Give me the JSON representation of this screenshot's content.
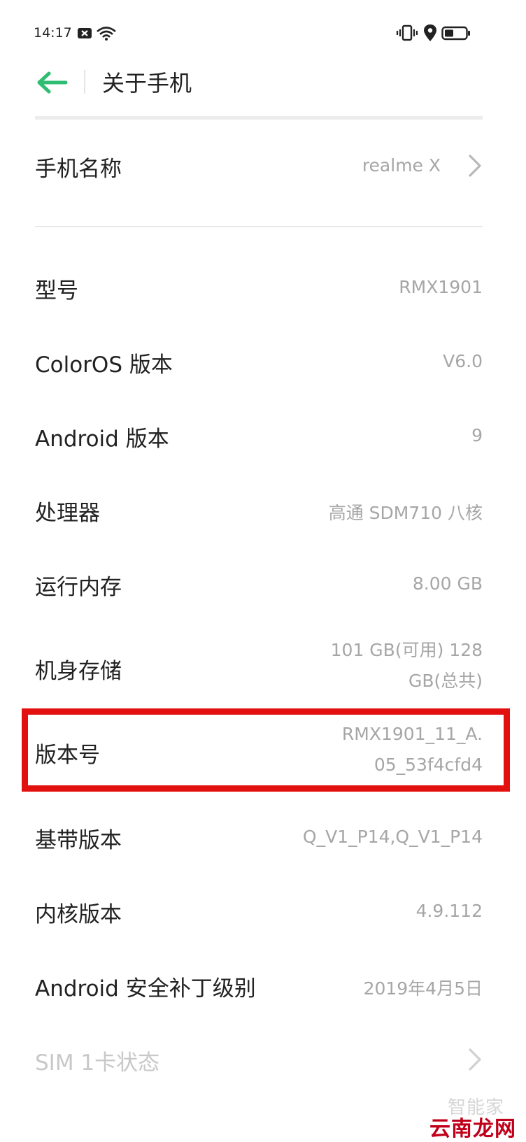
{
  "status_bar": {
    "time": "14:17",
    "icons": [
      "notification-close-icon",
      "wifi-icon",
      "vibrate-icon",
      "location-icon",
      "battery-icon"
    ]
  },
  "header": {
    "title": "关于手机",
    "back_icon": "back-arrow-icon",
    "accent_color": "#2ebd73"
  },
  "settings": {
    "phone_name": {
      "label": "手机名称",
      "value": "realme X"
    },
    "model": {
      "label": "型号",
      "value": "RMX1901"
    },
    "coloros_version": {
      "label": "ColorOS 版本",
      "value": "V6.0"
    },
    "android_version": {
      "label": "Android 版本",
      "value": "9"
    },
    "processor": {
      "label": "处理器",
      "value": "高通 SDM710 八核"
    },
    "ram": {
      "label": "运行内存",
      "value": "8.00 GB"
    },
    "storage": {
      "label": "机身存储",
      "value_line1": "101 GB(可用)  128",
      "value_line2": "GB(总共)"
    },
    "build_number": {
      "label": "版本号",
      "value_line1": "RMX1901_11_A.",
      "value_line2": "05_53f4cfd4"
    },
    "baseband_version": {
      "label": "基带版本",
      "value": "Q_V1_P14,Q_V1_P14"
    },
    "kernel_version": {
      "label": "内核版本",
      "value": "4.9.112"
    },
    "security_patch": {
      "label": "Android 安全补丁级别",
      "value": "2019年4月5日"
    },
    "sim1_status": {
      "label": "SIM 1卡状态"
    }
  },
  "annotation": {
    "highlight_color": "#e31010"
  },
  "watermark": {
    "top": "智能家",
    "bottom": "云南龙网"
  }
}
